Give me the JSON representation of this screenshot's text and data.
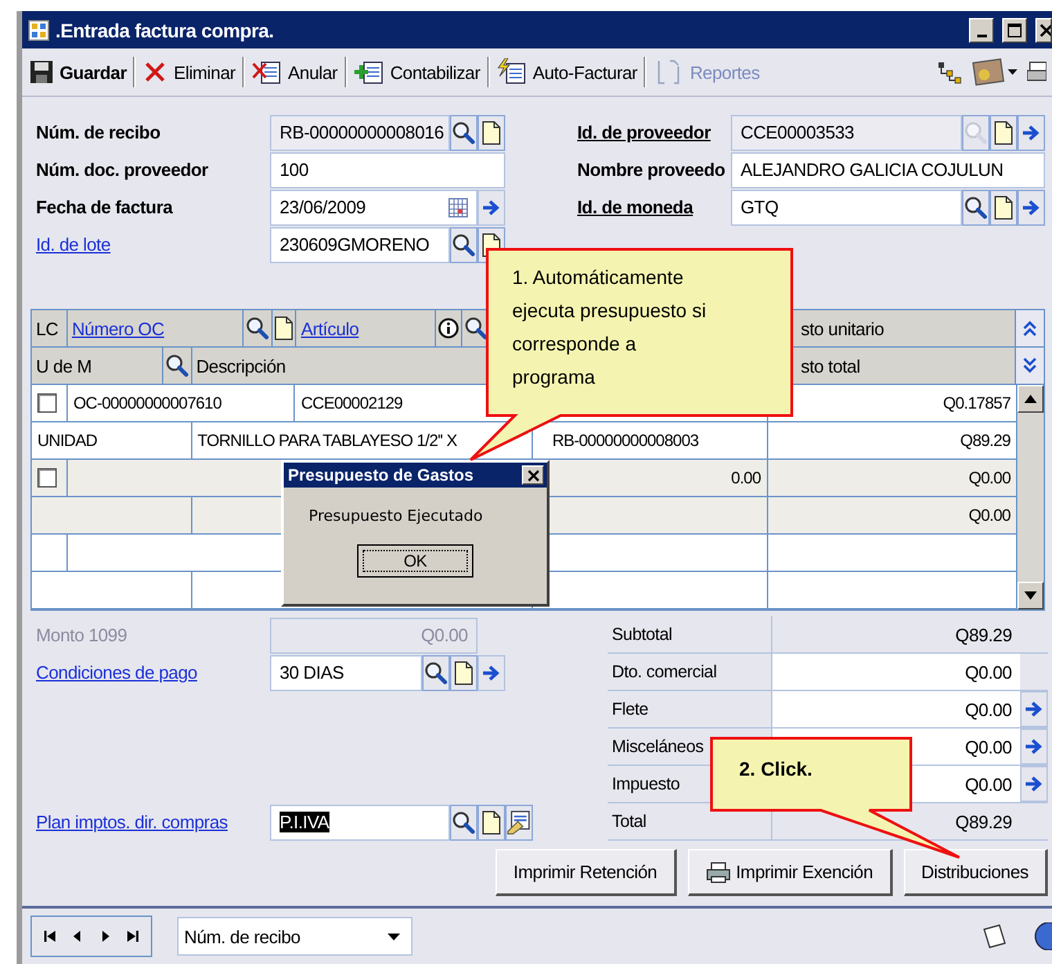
{
  "window": {
    "title": ".Entrada factura compra."
  },
  "toolbar": [
    {
      "label": "Guardar",
      "kind": "save",
      "disabled": false
    },
    {
      "label": "Eliminar",
      "kind": "delete",
      "disabled": false
    },
    {
      "label": "Anular",
      "kind": "void",
      "disabled": false
    },
    {
      "label": "Contabilizar",
      "kind": "post",
      "disabled": false
    },
    {
      "label": "Auto-Facturar",
      "kind": "auto",
      "disabled": false
    },
    {
      "label": "Reportes",
      "kind": "reports",
      "disabled": true
    }
  ],
  "header_left": [
    {
      "label": "Núm. de recibo",
      "kind": "bold",
      "value": "RB-00000000008016",
      "readonly": true,
      "tools": [
        {
          "kind": "lookup"
        },
        {
          "kind": "new"
        }
      ]
    },
    {
      "label": "Núm. doc. proveedor",
      "kind": "bold",
      "value": "100",
      "readonly": false
    },
    {
      "label": "Fecha de factura",
      "kind": "bold",
      "value": "23/06/2009",
      "readonly": false,
      "tools": [
        {
          "kind": "calendar_in"
        },
        {
          "kind": "go"
        }
      ]
    },
    {
      "label": "Id. de lote",
      "kind": "link",
      "value": "230609GMORENO",
      "readonly": false,
      "tools": [
        {
          "kind": "lookup"
        },
        {
          "kind": "new"
        }
      ]
    }
  ],
  "header_right": [
    {
      "label": "Id. de proveedor",
      "kind": "bold_link",
      "value": "CCE00003533",
      "readonly": true,
      "tools": [
        {
          "kind": "lookup_faded"
        },
        {
          "kind": "new"
        },
        {
          "kind": "go"
        }
      ]
    },
    {
      "label": "Nombre proveedo",
      "kind": "bold",
      "value": "ALEJANDRO GALICIA COJULUN",
      "readonly": false
    },
    {
      "label": "Id. de moneda",
      "kind": "bold_link",
      "value": "GTQ",
      "readonly": false,
      "tools": [
        {
          "kind": "lookup"
        },
        {
          "kind": "new"
        },
        {
          "kind": "go"
        }
      ]
    }
  ],
  "grid": {
    "columns_top": [
      {
        "label": "LC",
        "kind": "lc",
        "link": false
      },
      {
        "label": "Número OC",
        "kind": "order_number",
        "link": true,
        "tools": [
          {
            "kind": "lookup"
          },
          {
            "kind": "new"
          }
        ]
      },
      {
        "label": "Artículo",
        "kind": "article",
        "link": true,
        "tools": [
          {
            "kind": "info"
          },
          {
            "kind": "lookup"
          }
        ]
      },
      {
        "kind": "hidden"
      },
      {
        "label": "sto unitario",
        "kind": "cost",
        "link": false
      },
      {
        "kind": "collapse_button"
      }
    ],
    "columns_bottom": [
      {
        "label": "U de M",
        "kind": "uom",
        "link": false,
        "tools": [
          {
            "kind": "lookup"
          }
        ]
      },
      {
        "label": "Descripción",
        "kind": "description",
        "link": false
      },
      {
        "label": "sto total",
        "kind": "cost",
        "link": false
      },
      {
        "kind": "expand_button"
      }
    ],
    "rows": [
      {
        "kind": "order",
        "checked": false,
        "number": "OC-00000000007610",
        "article": "CCE00002129",
        "unit_cost": "Q0.17857",
        "pending": false
      },
      {
        "kind": "detail",
        "uom": "UNIDAD",
        "description": "TORNILLO PARA TABLAYESO 1/2'' X",
        "reference": "RB-00000000008003",
        "total": "Q89.29",
        "pending": false
      },
      {
        "kind": "order",
        "checked": false,
        "column_4": "0.00",
        "unit_cost": "Q0.00",
        "pending": true
      },
      {
        "kind": "detail",
        "total": "Q0.00",
        "pending": true
      },
      {
        "kind": "order",
        "pending": false
      },
      {
        "kind": "detail",
        "pending": false
      }
    ]
  },
  "bottom_left": [
    {
      "label": "Monto 1099",
      "value": "Q0.00",
      "disabled": true
    },
    {
      "label": "Condiciones de pago",
      "value": "30 DIAS",
      "disabled": false,
      "tools": [
        {
          "kind": "lookup"
        },
        {
          "kind": "new"
        },
        {
          "kind": "go"
        }
      ]
    }
  ],
  "tax_plan": {
    "label": "Plan imptos. dir. compras",
    "value": "P.I.IVA",
    "highlighted": true,
    "tools": [
      {
        "kind": "lookup"
      },
      {
        "kind": "new"
      },
      {
        "kind": "notes"
      }
    ]
  },
  "totals": [
    {
      "label": "Subtotal",
      "value": "Q89.29",
      "readonly": true,
      "go": false
    },
    {
      "label": "Dto. comercial",
      "value": "Q0.00",
      "readonly": false,
      "go": false
    },
    {
      "label": "Flete",
      "value": "Q0.00",
      "readonly": false,
      "go": true
    },
    {
      "label": "Misceláneos",
      "value": "Q0.00",
      "readonly": false,
      "go": true
    },
    {
      "label": "Impuesto",
      "value": "Q0.00",
      "readonly": false,
      "go": true
    },
    {
      "label": "Total",
      "value": "Q89.29",
      "readonly": true,
      "go": false
    }
  ],
  "buttons": [
    {
      "label": "Imprimir Retención",
      "kind": "plain"
    },
    {
      "label": "Imprimir Exención",
      "kind": "print"
    },
    {
      "label": "Distribuciones",
      "kind": "plain"
    }
  ],
  "navigator": {
    "sort_field": "Núm. de recibo"
  },
  "dialog": {
    "title": "Presupuesto de Gastos",
    "message": "Presupuesto Ejecutado",
    "button": "OK"
  },
  "callouts": [
    {
      "text": "1. Automáticamente ejecuta presupuesto si corresponde a programa"
    },
    {
      "text": "2. Click."
    }
  ]
}
